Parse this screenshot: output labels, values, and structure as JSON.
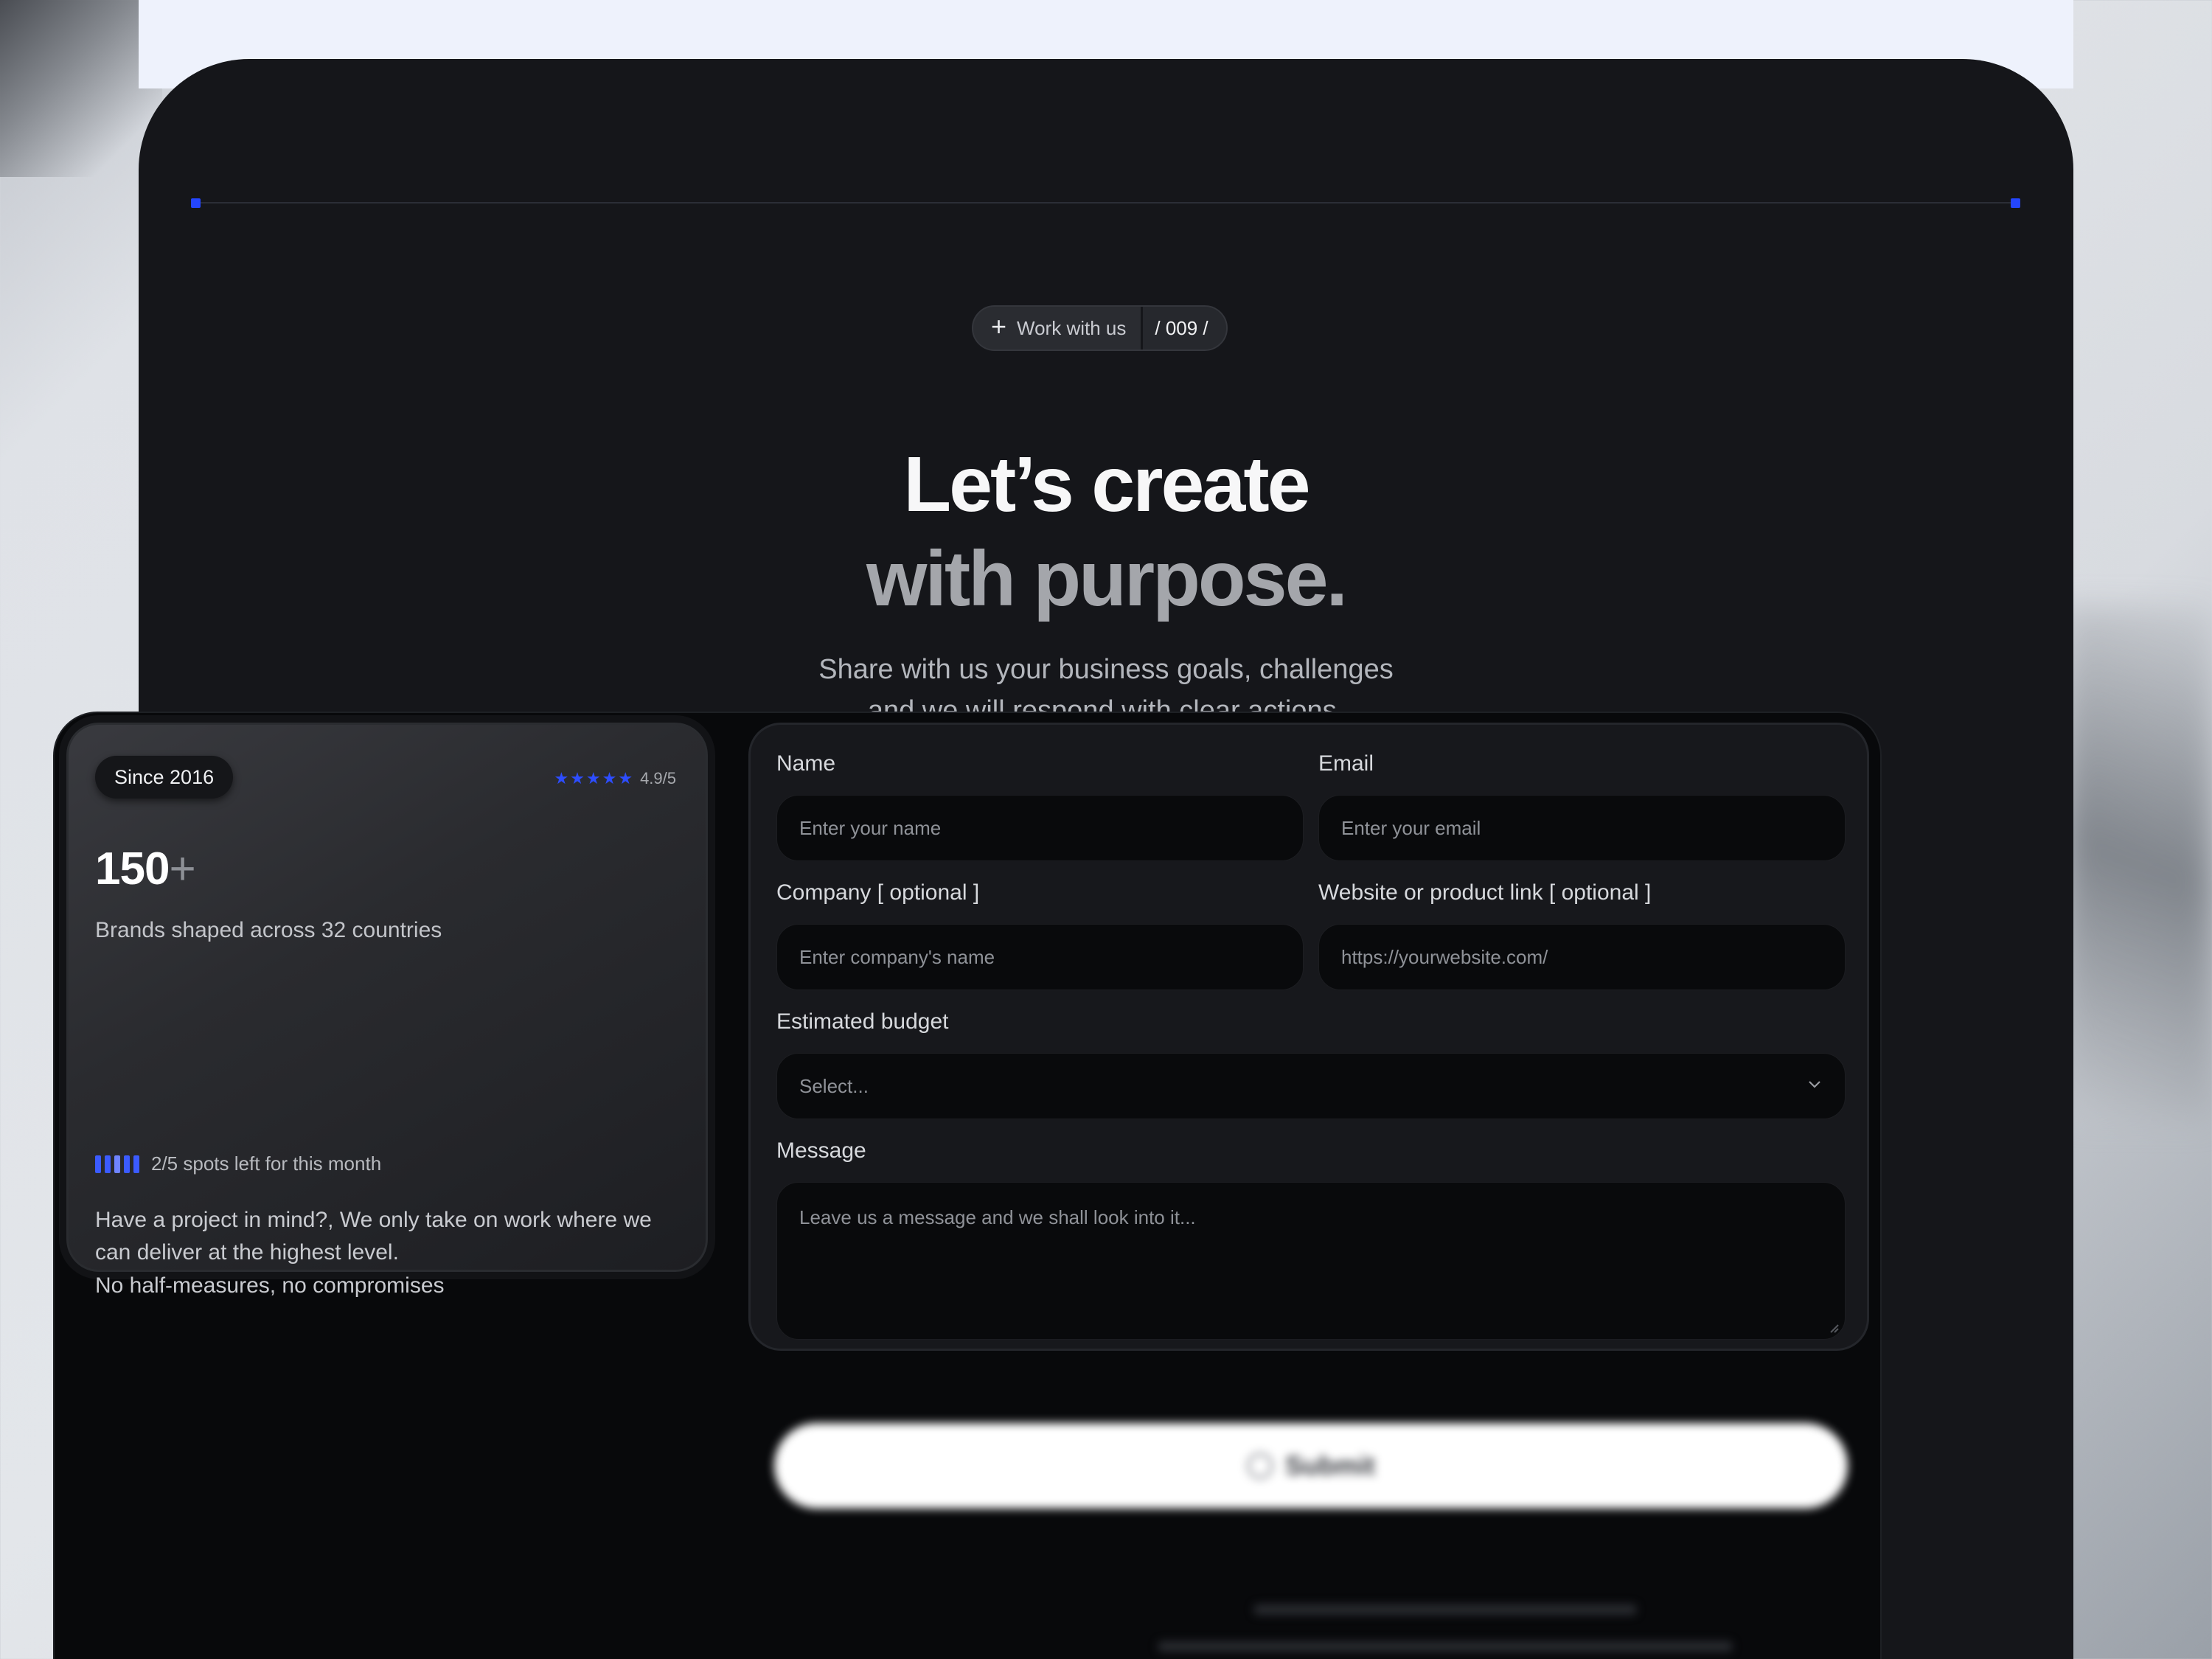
{
  "badge": {
    "label": "Work with us",
    "index": "/ 009 /"
  },
  "hero": {
    "title_line1": "Let’s create",
    "title_line2": "with purpose.",
    "subtitle_line1": "Share with us your business goals, challenges",
    "subtitle_line2": "and we will respond with clear actions."
  },
  "info": {
    "since": "Since 2016",
    "stars": "★★★★★",
    "rating": "4.9/5",
    "count": "150",
    "count_suffix": "+",
    "brands": "Brands shaped across 32 countries",
    "spots": "2/5 spots left for this month",
    "project": "Have a project in mind?, We only take on work where we can deliver at the highest level.",
    "no_half": "No half-measures, no compromises"
  },
  "form": {
    "name_label": "Name",
    "name_placeholder": "Enter your name",
    "email_label": "Email",
    "email_placeholder": "Enter your email",
    "company_label": "Company [ optional ]",
    "company_placeholder": "Enter company's name",
    "website_label": "Website or product link [ optional ]",
    "website_placeholder": "https://yourwebsite.com/",
    "budget_label": "Estimated budget",
    "budget_value": "Select...",
    "message_label": "Message",
    "message_placeholder": "Leave us a message and we shall look into it...",
    "submit_label": "Submit"
  },
  "colors": {
    "accent": "#2d4dff",
    "background": "#15161a",
    "field": "#090a0c"
  }
}
